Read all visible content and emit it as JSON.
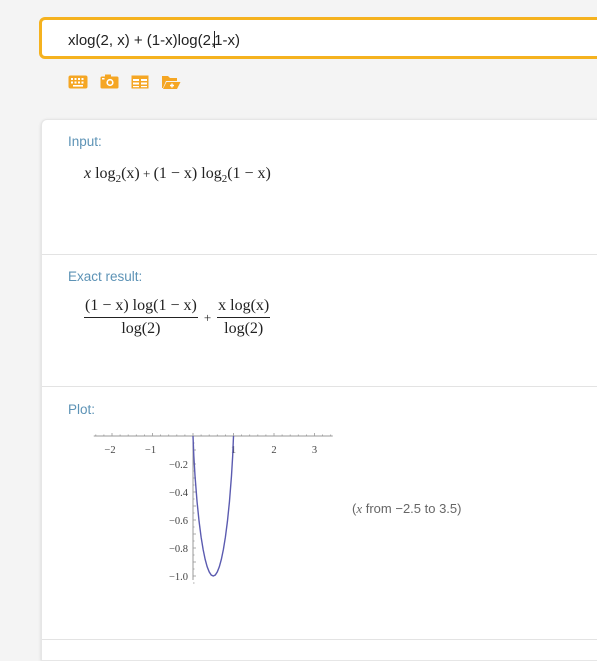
{
  "query": {
    "before_caret": "xlog(2, x) + (1-x)log(2,",
    "after_caret": "1-x)"
  },
  "toolbar": {
    "icons": [
      "keyboard-icon",
      "camera-icon",
      "table-icon",
      "folder-icon"
    ],
    "accent_color": "#f5a623"
  },
  "pods": {
    "input": {
      "title": "Input:",
      "math": {
        "x1": "x",
        "log1": "log",
        "sub1": "2",
        "arg1": "(x)",
        "plus": " + ",
        "paren": "(1 − x)",
        "log2": "log",
        "sub2": "2",
        "arg2": "(1 − x)"
      }
    },
    "exact": {
      "title": "Exact result:",
      "term1_num": "(1 − x) log(1 − x)",
      "term1_den": "log(2)",
      "plus": "+",
      "term2_num": "x log(x)",
      "term2_den": "log(2)"
    },
    "plot": {
      "title": "Plot:",
      "caption_x": "x",
      "caption_rest": " from −2.5 to 3.5)",
      "caption_open": "("
    }
  },
  "chart_data": {
    "type": "line",
    "function": "x log2(x) + (1 - x) log2(1 - x)",
    "x_ticks": [
      "−2",
      "−1",
      "1",
      "2",
      "3"
    ],
    "y_ticks": [
      "−0.2",
      "−0.4",
      "−0.6",
      "−0.8",
      "−1.0"
    ],
    "xlim": [
      -2.5,
      3.5
    ],
    "ylim": [
      -1.0,
      0
    ],
    "series": [
      {
        "color": "#5b5bb0",
        "x": [
          0,
          0.02,
          0.05,
          0.1,
          0.15,
          0.2,
          0.25,
          0.3,
          0.35,
          0.4,
          0.45,
          0.5,
          0.55,
          0.6,
          0.65,
          0.7,
          0.75,
          0.8,
          0.85,
          0.9,
          0.95,
          0.98,
          1
        ],
        "y": [
          0,
          -0.141,
          -0.286,
          -0.469,
          -0.61,
          -0.722,
          -0.811,
          -0.881,
          -0.934,
          -0.971,
          -0.993,
          -1.0,
          -0.993,
          -0.971,
          -0.934,
          -0.881,
          -0.811,
          -0.722,
          -0.61,
          -0.469,
          -0.286,
          -0.141,
          0
        ]
      }
    ]
  }
}
